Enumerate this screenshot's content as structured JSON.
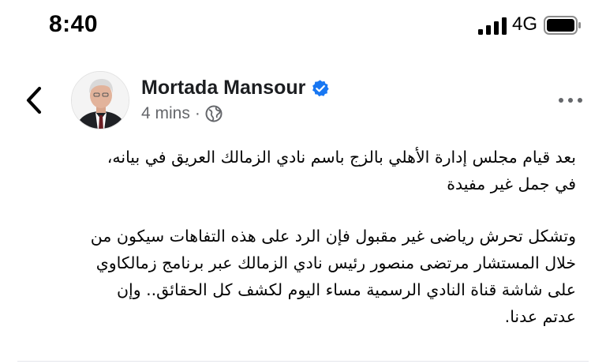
{
  "status_bar": {
    "time": "8:40",
    "network": "4G",
    "icons": [
      "signal-icon",
      "battery-icon"
    ]
  },
  "post": {
    "author": "Mortada Mansour",
    "verified": true,
    "time_ago": "4 mins",
    "separator": "·",
    "audience_icon": "globe-icon",
    "back_icon": "chevron-left-icon",
    "more_icon": "more-horizontal-icon",
    "paragraphs": [
      "بعد  قيام مجلس إدارة الأهلي بالزج باسم نادي الزمالك العريق في بيانه،\nفي جمل غير مفيدة",
      "وتشكل تحرش رياضى غير مقبول فإن الرد على هذه التفاهات  سيكون من\nخلال  المستشار مرتضى منصور رئيس نادي الزمالك عبر برنامج زمالكاوي\nعلى شاشة قناة النادي الرسمية  مساء اليوم لكشف كل الحقائق.. وإن\nعدتم عدنا."
    ]
  },
  "colors": {
    "verified_blue": "#1877f2",
    "meta_gray": "#65676b",
    "text": "#050505"
  }
}
